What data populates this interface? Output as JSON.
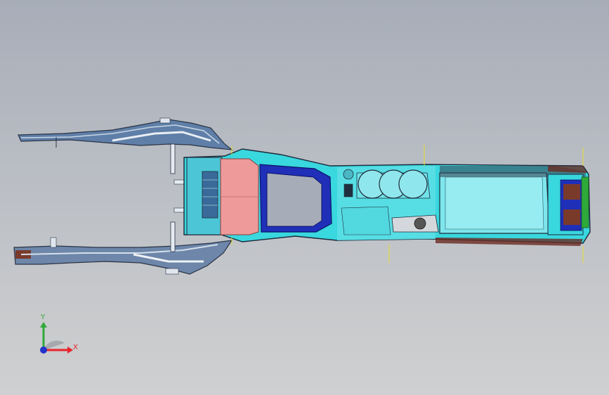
{
  "viewport": {
    "colors": {
      "background_top": "#a7adb8",
      "background_bottom": "#cfd0d1",
      "console_cyan": "#39d7de",
      "console_light_cyan": "#8fe6ec",
      "console_blue": "#1f2fb8",
      "pink_panel": "#ee9a9a",
      "dark_frame": "#2f3a4a",
      "green_panel": "#2faa3a",
      "brown_trim": "#7a3a2a",
      "yellow_marker": "#e6e02a"
    }
  },
  "triad": {
    "x_label": "X",
    "y_label": "Y",
    "x_color": "#e8232a",
    "y_color": "#2faa3a",
    "z_color": "#2233cc"
  }
}
